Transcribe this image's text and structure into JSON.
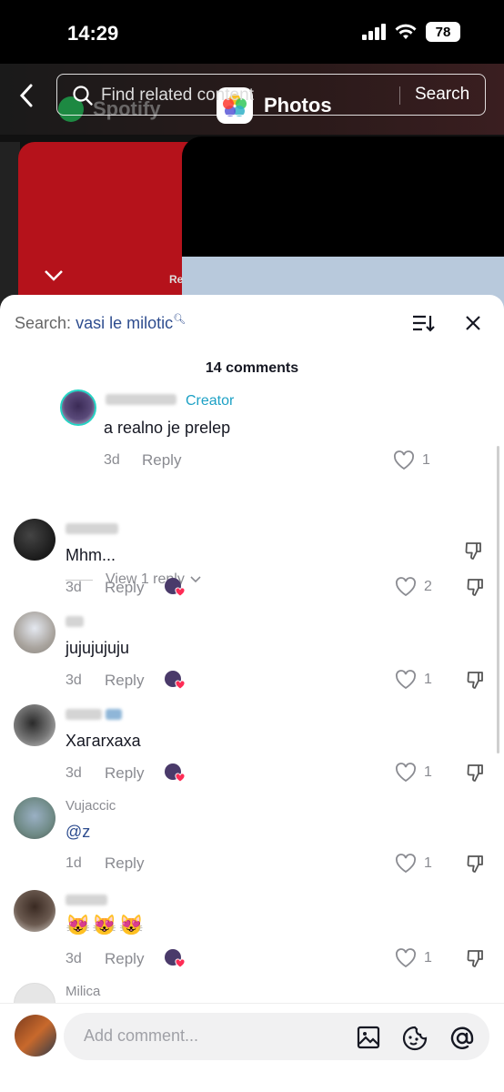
{
  "status_bar": {
    "time": "14:29",
    "battery": "78"
  },
  "video_overlay": {
    "search_placeholder": "Find related content",
    "search_button": "Search",
    "app_label_spotify": "Spotify",
    "app_label_photos": "Photos",
    "partial_text": "Re"
  },
  "sheet": {
    "search_prefix": "Search:",
    "search_query": "vasi le milotic",
    "comment_count": "14 comments"
  },
  "comments": [
    {
      "username": "",
      "badge": "Creator",
      "text": "a realno je prelep",
      "age": "3d",
      "reply": "Reply",
      "likes": "1",
      "view_replies": "View 1 reply"
    },
    {
      "username": "",
      "text": "Mhm...",
      "age": "3d",
      "reply": "Reply",
      "likes": "2"
    },
    {
      "username": "",
      "text": "jujujujuju",
      "age": "3d",
      "reply": "Reply",
      "likes": "1"
    },
    {
      "username": "",
      "text": "Xaгarxaxa",
      "age": "3d",
      "reply": "Reply",
      "likes": "1"
    },
    {
      "username": "Vujaccic",
      "text": "@z",
      "age": "1d",
      "reply": "Reply",
      "likes": "1"
    },
    {
      "username": "",
      "text": "😻😻😻",
      "age": "3d",
      "reply": "Reply",
      "likes": "1"
    },
    {
      "username": "Milica",
      "text": ""
    }
  ],
  "composer": {
    "placeholder": "Add comment..."
  },
  "colors": {
    "accent_blue": "#2e4d8f",
    "creator_teal": "#1da1c5",
    "muted": "#8a8b91",
    "text": "#161823"
  }
}
